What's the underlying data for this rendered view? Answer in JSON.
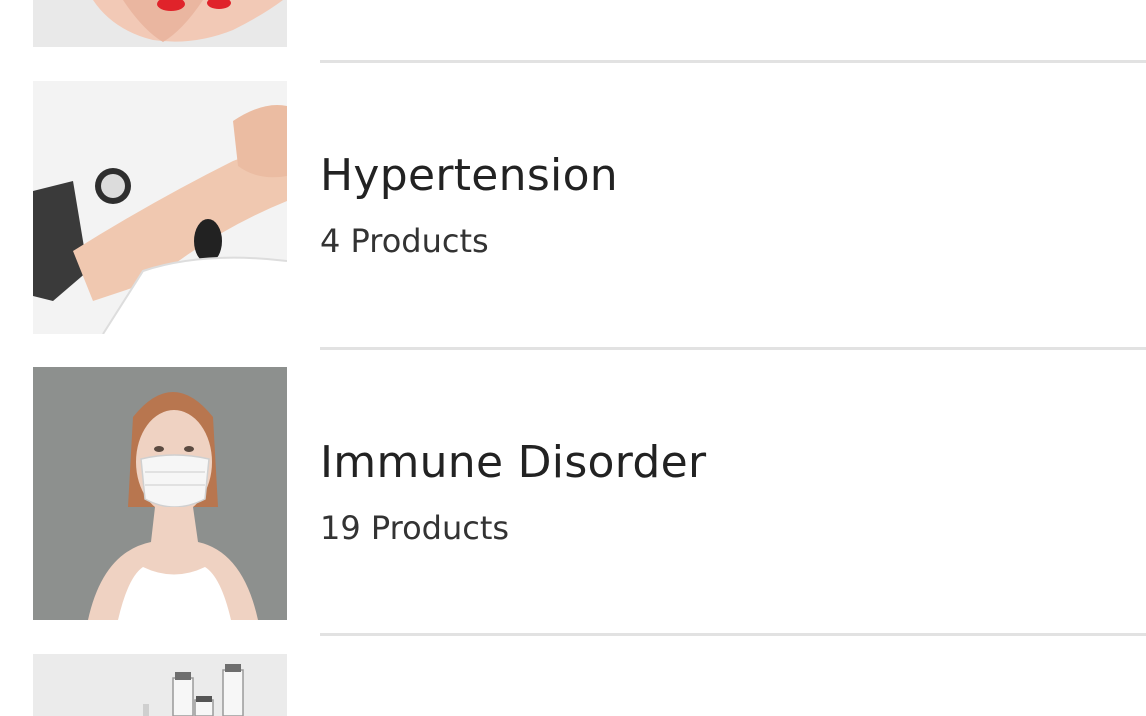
{
  "categories": [
    {
      "title": "",
      "count": "",
      "image": "hands-holding-red-heart"
    },
    {
      "title": "Hypertension",
      "count": "4 Products",
      "image": "blood-pressure-measurement"
    },
    {
      "title": "Immune Disorder",
      "count": "19 Products",
      "image": "woman-wearing-face-mask"
    },
    {
      "title": "",
      "count": "",
      "image": "medicine-vials"
    }
  ],
  "colors": {
    "background": "#ffffff",
    "divider": "#e2e2e2",
    "title_text": "#222222",
    "count_text": "#333333"
  }
}
